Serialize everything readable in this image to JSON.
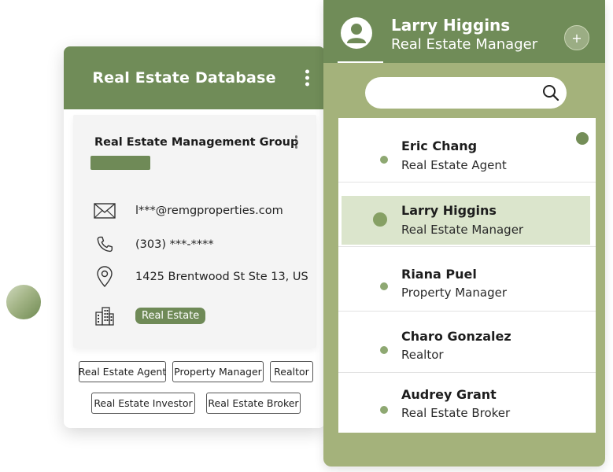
{
  "database_card": {
    "title": "Real Estate Database",
    "company": {
      "name": "Real Estate Management Group",
      "email": "l***@remgproperties.com",
      "phone": "(303) ***-****",
      "address": "1425 Brentwood St Ste 13, US",
      "category": "Real Estate"
    },
    "chips": [
      "Real Estate Agent",
      "Property Manager",
      "Realtor",
      "Real Estate Investor",
      "Real Estate Broker"
    ]
  },
  "contacts_panel": {
    "user": {
      "name": "Larry Higgins",
      "role": "Real Estate Manager"
    },
    "add_label": "+",
    "search": {
      "placeholder": ""
    },
    "contacts": [
      {
        "name": "Eric Chang",
        "role": "Real Estate Agent"
      },
      {
        "name": "Larry Higgins",
        "role": "Real Estate Manager",
        "selected": true
      },
      {
        "name": "Riana Puel",
        "role": "Property Manager"
      },
      {
        "name": "Charo Gonzalez",
        "role": "Realtor"
      },
      {
        "name": "Audrey Grant",
        "role": "Real Estate Broker"
      }
    ]
  },
  "colors": {
    "header_green": "#708c58",
    "panel_green": "#a4b27b",
    "accent_green": "#6f8a57",
    "selected_bg": "#dbe5cc"
  },
  "icons": [
    "kebab-menu-icon",
    "mail-icon",
    "phone-icon",
    "location-pin-icon",
    "building-icon",
    "user-avatar-icon",
    "plus-icon",
    "search-icon"
  ]
}
